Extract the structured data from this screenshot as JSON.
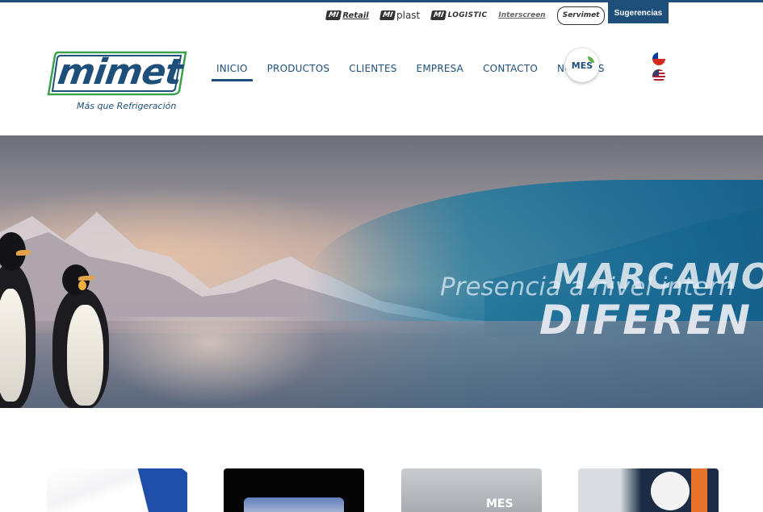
{
  "brands": [
    {
      "mark": "MI",
      "name": "Retail"
    },
    {
      "mark": "MI",
      "name": "plast"
    },
    {
      "mark": "MI",
      "name": "LOGISTIC"
    },
    {
      "mark": "",
      "name": "Interscreen"
    },
    {
      "mark": "",
      "name": "Servimet"
    }
  ],
  "header": {
    "sugerencias_label": "Sugerencias",
    "logo_text": "mimet",
    "logo_tagline": "Más que Refrigeración",
    "mes_label": "MES"
  },
  "nav": {
    "items": [
      {
        "label": "INICIO",
        "active": true
      },
      {
        "label": "PRODUCTOS",
        "active": false
      },
      {
        "label": "CLIENTES",
        "active": false
      },
      {
        "label": "EMPRESA",
        "active": false
      },
      {
        "label": "CONTACTO",
        "active": false
      },
      {
        "label": "NOTICIAS",
        "active": false
      }
    ]
  },
  "languages": [
    {
      "code": "es-CL",
      "icon": "chile-flag-icon"
    },
    {
      "code": "en-US",
      "icon": "usa-flag-icon"
    }
  ],
  "hero": {
    "line1": "MARCAMO",
    "line2": "Presencia a nivel intern",
    "line3": "DIFEREN"
  },
  "thumbnails": {
    "mes_label": "MES"
  },
  "colors": {
    "brand_blue": "#1d4f7a",
    "brand_green": "#3aa24a"
  }
}
